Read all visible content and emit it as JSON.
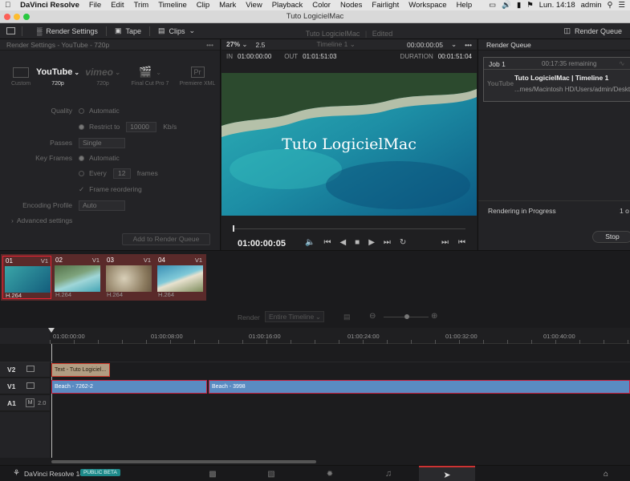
{
  "menubar": {
    "app": "DaVinci Resolve",
    "items": [
      "File",
      "Edit",
      "Trim",
      "Timeline",
      "Clip",
      "Mark",
      "View",
      "Playback",
      "Color",
      "Nodes",
      "Fairlight",
      "Workspace",
      "Help"
    ],
    "clock": "Lun. 14:18",
    "user": "admin"
  },
  "window": {
    "title": "Tuto LogicielMac"
  },
  "toolbar": {
    "render_settings": "Render Settings",
    "tape": "Tape",
    "clips": "Clips",
    "render_queue": "Render Queue"
  },
  "render_settings": {
    "header": "Render Settings - YouTube - 720p",
    "presets": [
      {
        "name": "Custom",
        "label": "Custom"
      },
      {
        "name": "youtube",
        "label": "720p",
        "logo": "YouTube"
      },
      {
        "name": "vimeo",
        "label": "720p",
        "logo": "vimeo"
      },
      {
        "name": "final-cut",
        "label": "Final Cut Pro 7"
      },
      {
        "name": "premiere",
        "label": "Premiere XML",
        "logo": "Pr"
      }
    ],
    "quality_label": "Quality",
    "quality_auto": "Automatic",
    "restrict_label": "Restrict to",
    "restrict_value": "10000",
    "restrict_unit": "Kb/s",
    "passes_label": "Passes",
    "passes_value": "Single",
    "keyframes_label": "Key Frames",
    "keyframes_auto": "Automatic",
    "every_label": "Every",
    "every_value": "12",
    "every_unit": "frames",
    "frame_reorder": "Frame reordering",
    "encoding_label": "Encoding Profile",
    "encoding_value": "Auto",
    "advanced": "Advanced settings",
    "add_button": "Add to Render Queue"
  },
  "viewer": {
    "zoom": "27%",
    "ratio": "2.5",
    "project": "Tuto LogicielMac",
    "status": "Edited",
    "timeline_name": "Timeline 1",
    "timecode_top": "00:00:00:05",
    "in_label": "IN",
    "in_tc": "01:00:00:00",
    "out_label": "OUT",
    "out_tc": "01:01:51:03",
    "duration_label": "DURATION",
    "duration_tc": "00:01:51:04",
    "overlay_title": "Tuto LogicielMac",
    "current_tc": "01:00:00:05"
  },
  "render_queue": {
    "title": "Render Queue",
    "job_name": "Job 1",
    "remaining": "00:17:35 remaining",
    "job_title": "Tuto LogicielMac | Timeline 1",
    "job_path": "...mes/Macintosh HD/Users/admin/Deskto",
    "yt": "YouTube",
    "progress_label": "Rendering in Progress",
    "progress_count": "1 o",
    "stop": "Stop"
  },
  "clips": [
    {
      "num": "01",
      "track": "V1",
      "codec": "H.264"
    },
    {
      "num": "02",
      "track": "V1",
      "codec": "H.264"
    },
    {
      "num": "03",
      "track": "V1",
      "codec": "H.264"
    },
    {
      "num": "04",
      "track": "V1",
      "codec": "H.264"
    }
  ],
  "timeline": {
    "render_label": "Render",
    "render_range": "Entire Timeline",
    "ruler": [
      "01:00:00:00",
      "01:00:08:00",
      "01:00:16:00",
      "01:00:24:00",
      "01:00:32:00",
      "01:00:40:00"
    ],
    "tracks": [
      "V2",
      "V1",
      "A1"
    ],
    "audio_m": "M",
    "audio_level": "2.0",
    "text_clip": "Text - Tuto Logiciel...",
    "v1_clip1": "Beach - 7262-2",
    "v1_clip2": "Beach - 3998"
  },
  "bottom": {
    "app": "DaVinci Resolve 14",
    "badge": "PUBLIC BETA"
  }
}
